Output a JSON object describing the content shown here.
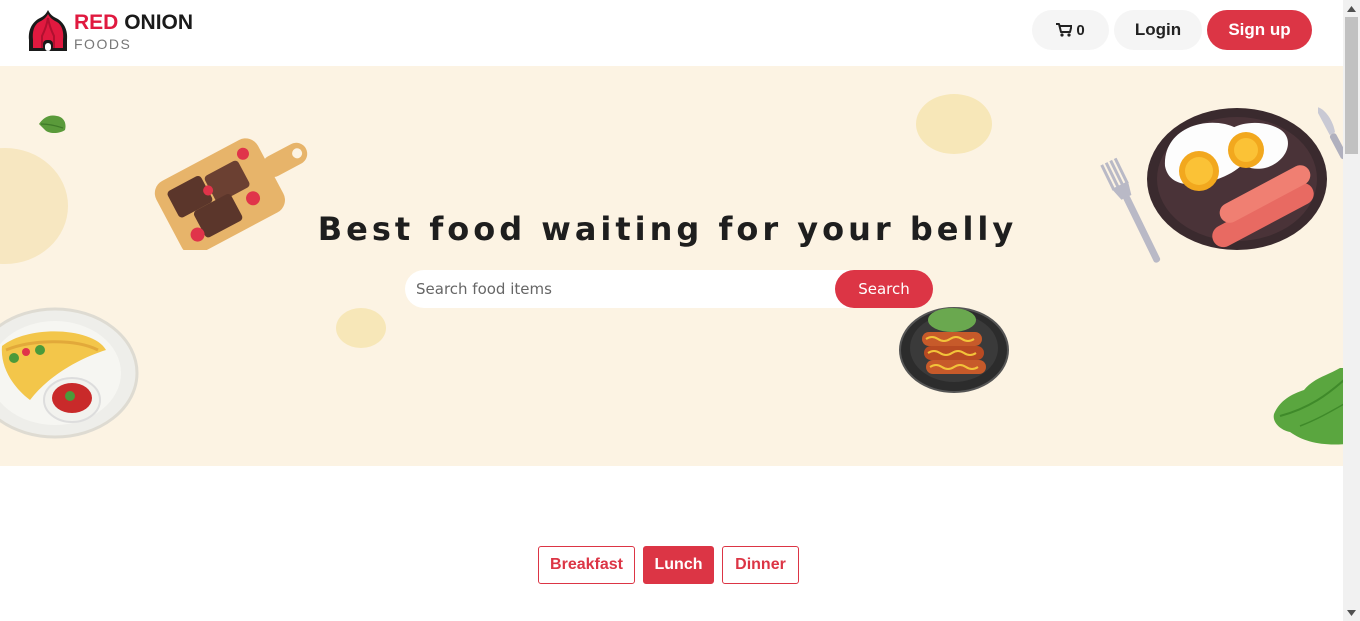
{
  "header": {
    "logo": {
      "brand_red": "RED",
      "brand_dark": "ONION",
      "sub": "FOODS"
    },
    "cart": {
      "icon": "cart-icon",
      "count": "0"
    },
    "login_label": "Login",
    "signup_label": "Sign up"
  },
  "hero": {
    "title": "Best food waiting for your belly",
    "search": {
      "placeholder": "Search food items",
      "value": "",
      "button_label": "Search"
    }
  },
  "tabs": [
    {
      "label": "Breakfast",
      "active": false
    },
    {
      "label": "Lunch",
      "active": true
    },
    {
      "label": "Dinner",
      "active": false
    }
  ],
  "colors": {
    "accent": "#dc3545",
    "hero_bg": "#fcf3e3",
    "brand_red": "#e0193f"
  }
}
